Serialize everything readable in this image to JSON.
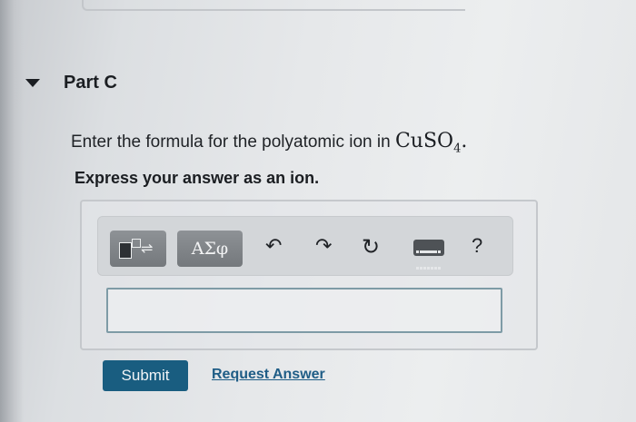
{
  "part": {
    "title": "Part C"
  },
  "question": {
    "text": "Enter the formula for the polyatomic ion in ",
    "formula_main": "CuSO",
    "formula_subscript": "4",
    "period": "."
  },
  "instruction": "Express your answer as an ion.",
  "toolbar": {
    "symbols_label": "ΑΣφ",
    "undo_glyph": "↶",
    "redo_glyph": "↷",
    "reset_glyph": "↻",
    "help_label": "?",
    "icons": [
      "templates-icon",
      "undo-icon",
      "redo-icon",
      "reset-icon",
      "keyboard-icon",
      "help-icon"
    ]
  },
  "answer": {
    "value": ""
  },
  "actions": {
    "submit_label": "Submit",
    "request_answer_label": "Request Answer"
  },
  "colors": {
    "submit_bg": "#195d80",
    "link": "#1f5d86",
    "input_border": "#7e9ba6",
    "tool_button_bg": "#7e8286"
  }
}
